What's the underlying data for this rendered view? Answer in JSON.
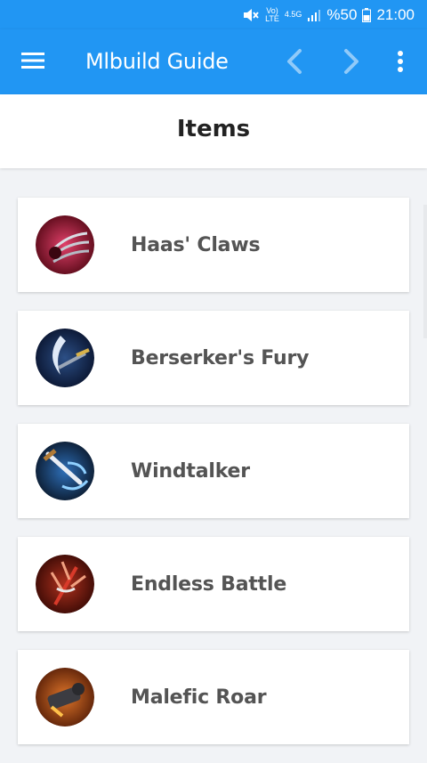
{
  "status_bar": {
    "volte_top": "Vo)",
    "volte_bottom": "LTE",
    "network": "4.5G",
    "battery": "%50",
    "time": "21:00",
    "icons": [
      "mute-icon",
      "signal-icon",
      "battery-icon"
    ]
  },
  "app_bar": {
    "title": "Mlbuild Guide",
    "icons": [
      "menu-icon",
      "chevron-left-icon",
      "chevron-right-icon",
      "more-vertical-icon"
    ],
    "color": "#2196f3"
  },
  "section": {
    "title": "Items"
  },
  "items": [
    {
      "label": "Haas' Claws",
      "icon": "claws-icon"
    },
    {
      "label": "Berserker's Fury",
      "icon": "axe-icon"
    },
    {
      "label": "Windtalker",
      "icon": "wind-blade-icon"
    },
    {
      "label": "Endless Battle",
      "icon": "trident-icon"
    },
    {
      "label": "Malefic Roar",
      "icon": "cannon-icon"
    }
  ]
}
